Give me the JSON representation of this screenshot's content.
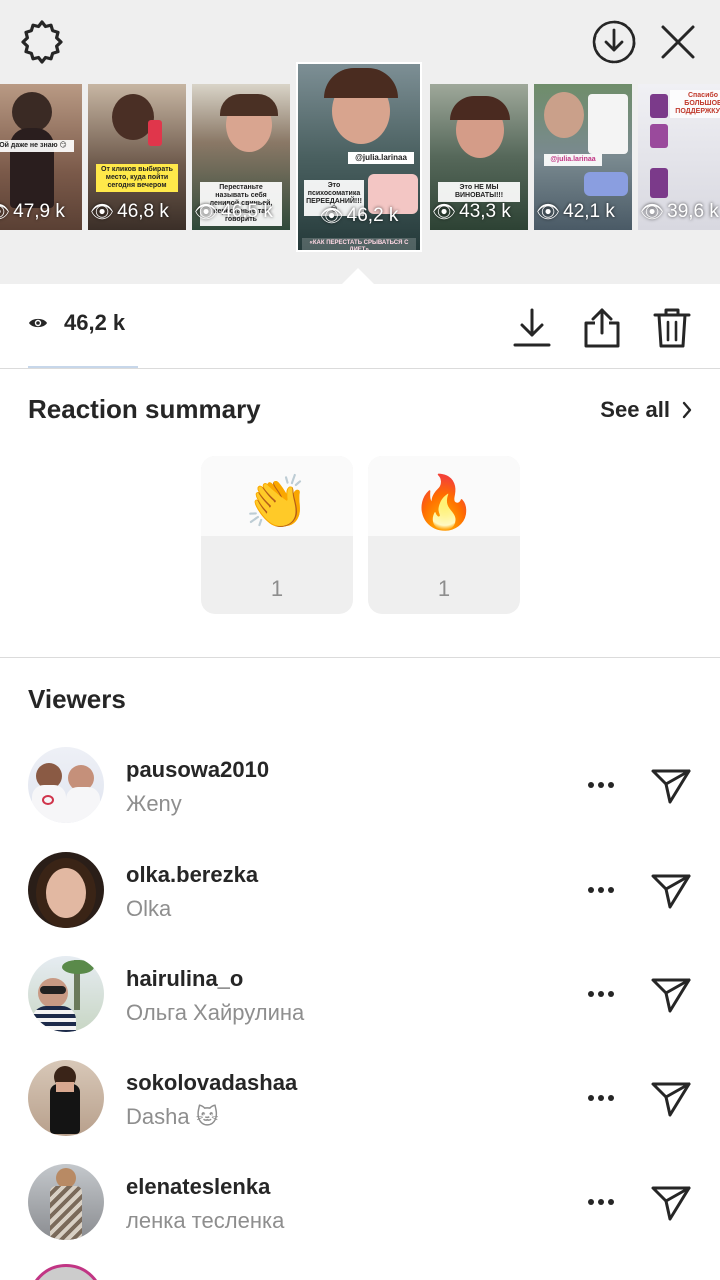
{
  "header": {
    "settings_icon": "gear-icon",
    "save_icon": "download-circle-icon",
    "close_icon": "close-icon"
  },
  "story_thumbnails": [
    {
      "views": "47,9 k",
      "caption": "Ой даже не знаю 😏",
      "bg": "#8a6a5a",
      "active": false
    },
    {
      "views": "46,8 k",
      "caption": "От кликов выбирать место, куда пойти сегодня вечером",
      "bg": "#5a4f47",
      "active": false
    },
    {
      "views": "46,5 k",
      "caption": "Перестаньте называть себя ленивой свиньей, перестаньте так говорить",
      "bg": "#3d5540",
      "active": false
    },
    {
      "views": "46,2 k",
      "caption": "Это психосоматика ПЕРЕЕДАНИЙ!!! 😵",
      "handle": "@julia.larinaa",
      "footer": "«КАК ПЕРЕСТАТЬ СРЫВАТЬСЯ С ДИЕТ»",
      "bg": "#4a6060",
      "active": true
    },
    {
      "views": "43,3 k",
      "caption": "Это НЕ МЫ ВИНОВАТЫ!!!",
      "bg": "#3f5a48",
      "active": false
    },
    {
      "views": "42,1 k",
      "caption": "@julia.larinaa",
      "bg": "#62707a",
      "active": false
    },
    {
      "views": "39,6 k",
      "caption": "Спасибо БОЛЬШОЕ ПОДДЕРЖКУ ❤️",
      "bg": "#d8d8e0",
      "active": false
    }
  ],
  "stats": {
    "views": "46,2 k",
    "eye_icon": "eye-icon",
    "download_icon": "download-icon",
    "share_icon": "share-icon",
    "delete_icon": "trash-icon"
  },
  "reaction_summary": {
    "title": "Reaction summary",
    "see_all": "See all",
    "reactions": [
      {
        "emoji": "👏",
        "count": "1"
      },
      {
        "emoji": "🔥",
        "count": "1"
      }
    ]
  },
  "viewers": {
    "title": "Viewers",
    "list": [
      {
        "username": "pausowa2010",
        "name": "Жeny"
      },
      {
        "username": "olka.berezka",
        "name": "Olka"
      },
      {
        "username": "hairulina_o",
        "name": "Ольга Хайрулина"
      },
      {
        "username": "sokolovadashaa",
        "name": "Dasha 🐱"
      },
      {
        "username": "elenateslenka",
        "name": "ленка тесленка"
      }
    ]
  },
  "colors": {
    "top_bg": "#efefef",
    "text_primary": "#262626",
    "text_secondary": "#8e8e8e",
    "divider": "#dbdbdb"
  }
}
